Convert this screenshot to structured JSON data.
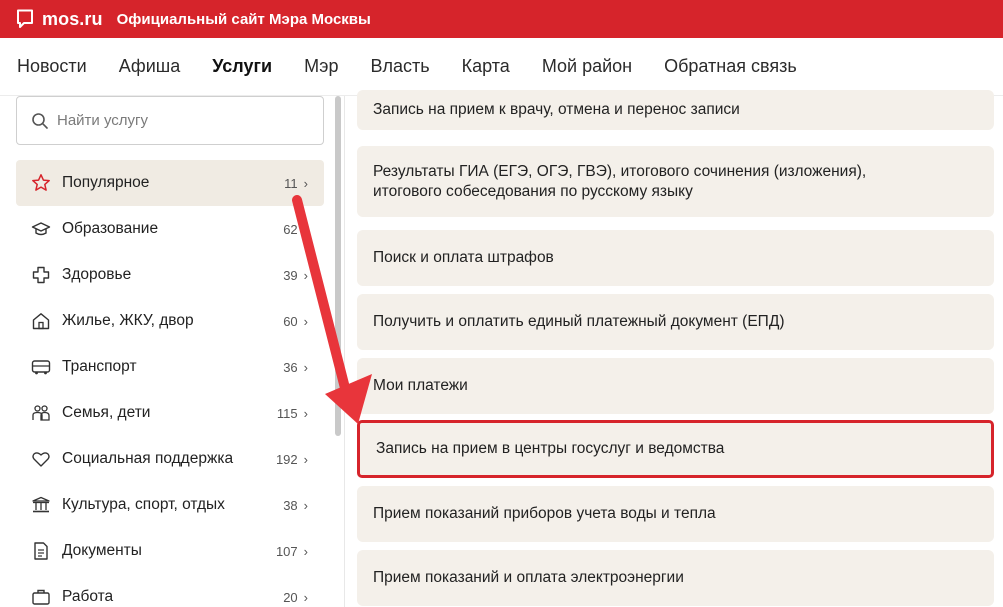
{
  "header": {
    "brand": "mos.ru",
    "subtitle": "Официальный сайт Мэра Москвы",
    "brand_color": "#d6242b"
  },
  "nav": {
    "items": [
      "Новости",
      "Афиша",
      "Услуги",
      "Мэр",
      "Власть",
      "Карта",
      "Мой район",
      "Обратная связь"
    ],
    "active": "Услуги"
  },
  "search": {
    "placeholder": "Найти услугу",
    "icon": "search-icon"
  },
  "categories": [
    {
      "label": "Популярное",
      "count": "11",
      "icon": "star-icon",
      "active": true
    },
    {
      "label": "Образование",
      "count": "62",
      "icon": "graduation-cap-icon"
    },
    {
      "label": "Здоровье",
      "count": "39",
      "icon": "medical-cross-icon"
    },
    {
      "label": "Жилье, ЖКУ, двор",
      "count": "60",
      "icon": "house-icon"
    },
    {
      "label": "Транспорт",
      "count": "36",
      "icon": "bus-icon"
    },
    {
      "label": "Семья, дети",
      "count": "115",
      "icon": "family-icon"
    },
    {
      "label": "Социальная поддержка",
      "count": "192",
      "icon": "heart-icon"
    },
    {
      "label": "Культура, спорт, отдых",
      "count": "38",
      "icon": "museum-icon"
    },
    {
      "label": "Документы",
      "count": "107",
      "icon": "document-icon"
    },
    {
      "label": "Работа",
      "count": "20",
      "icon": "briefcase-icon"
    }
  ],
  "services": [
    "Запись на прием к врачу, отмена и перенос записи",
    "Результаты ГИА (ЕГЭ, ОГЭ, ГВЭ), итогового сочинения (изложения),\nитогового собеседования по русскому языку",
    "Поиск и оплата штрафов",
    "Получить и оплатить единый платежный документ (ЕПД)",
    "Мои платежи",
    "Запись на прием в центры госуслуг и ведомства",
    "Прием показаний приборов учета воды и тепла",
    "Прием показаний и оплата электроэнергии"
  ],
  "highlighted_service": "Запись на прием в центры госуслуг и ведомства",
  "annotation": {
    "arrow_color": "#e8353b",
    "icon": "annotation-arrow"
  }
}
